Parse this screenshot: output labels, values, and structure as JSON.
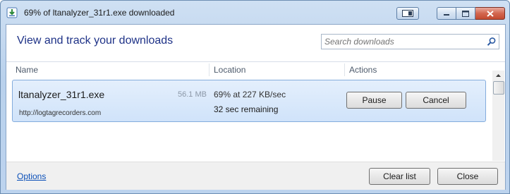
{
  "window": {
    "title": "69% of ltanalyzer_31r1.exe downloaded"
  },
  "header": {
    "heading": "View and track your downloads",
    "search_placeholder": "Search downloads"
  },
  "columns": {
    "name": "Name",
    "location": "Location",
    "actions": "Actions"
  },
  "download": {
    "file_name": "ltanalyzer_31r1.exe",
    "size": "56.1 MB",
    "url": "http://logtagrecorders.com",
    "progress_text": "69% at 227 KB/sec",
    "progress_percent": 69,
    "remaining": "32 sec remaining",
    "pause_label": "Pause",
    "cancel_label": "Cancel"
  },
  "footer": {
    "options_label": "Options",
    "clear_list_label": "Clear list",
    "close_label": "Close"
  },
  "colors": {
    "heading": "#1e3287",
    "link": "#0a4fb8",
    "selection": "#d0e3fa",
    "close_button": "#c44a30"
  }
}
